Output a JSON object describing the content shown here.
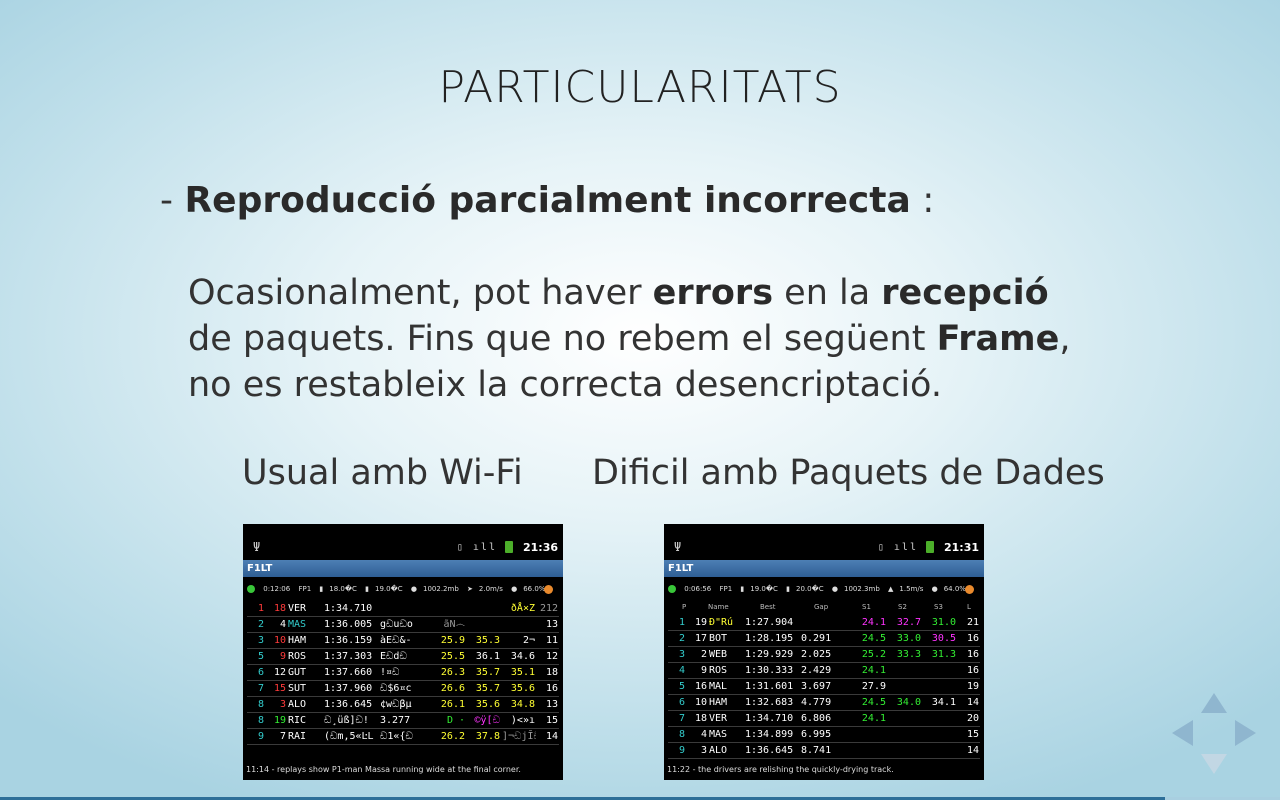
{
  "slide": {
    "title": "PARTICULARITATS",
    "bullet_dash": "- ",
    "bullet_bold": "Reproducció parcialment incorrecta",
    "bullet_colon": " :",
    "para": {
      "t1": "Ocasionalment, pot haver ",
      "b1": "errors",
      "t2": " en la ",
      "b2": "recepció",
      "t3": " de paquets. Fins que no rebem el següent ",
      "b3": "Frame",
      "t4": ", no es restableix la correcta desencriptació."
    },
    "caption_left": "Usual amb Wi-Fi",
    "caption_right": "Dificil amb Paquets de Dades",
    "progress_fraction": 0.91
  },
  "phone_left": {
    "usb_icon": "usb-icon",
    "clock": "21:36",
    "app_title": "F1LT",
    "session_time": "0:12:06",
    "session": "FP1",
    "air_temp": "18.0�C",
    "track_temp": "19.0�C",
    "pressure": "1002.2mb",
    "wind": "2.0m/s",
    "humidity": "66.0%",
    "rows": [
      {
        "pos": "1",
        "num": "18",
        "driver": "VER",
        "best": "1:34.710",
        "gap": "",
        "s1": "",
        "s2": "",
        "s3": "ðÅ×Z",
        "lap": "212",
        "pos_c": "c-red",
        "num_c": "c-red",
        "drv_c": "c-white",
        "s1_c": "c-yellow",
        "s2_c": "c-yellow",
        "s3_c": "c-yellow",
        "lap_c": "c-grey"
      },
      {
        "pos": "2",
        "num": "4",
        "driver": "MAS",
        "best": "1:36.005",
        "gap": "gඩuඩo",
        "s1": "ãN෴",
        "s2": "",
        "s3": "",
        "lap": "13",
        "pos_c": "c-cyan",
        "num_c": "c-white",
        "drv_c": "c-cyan",
        "s1_c": "c-grey",
        "s2_c": "c-white",
        "s3_c": "c-white",
        "lap_c": "c-white"
      },
      {
        "pos": "3",
        "num": "10",
        "driver": "HAM",
        "best": "1:36.159",
        "gap": "àEඩ&-",
        "s1": "25.9",
        "s2": "35.3",
        "s3": "2¬",
        "lap": "11",
        "pos_c": "c-cyan",
        "num_c": "c-red",
        "drv_c": "c-white",
        "s1_c": "c-yellow",
        "s2_c": "c-yellow",
        "s3_c": "c-white",
        "lap_c": "c-white"
      },
      {
        "pos": "5",
        "num": "9",
        "driver": "ROS",
        "best": "1:37.303",
        "gap": "Eඩdඩ",
        "s1": "25.5",
        "s2": "36.1",
        "s3": "34.6",
        "lap": "12",
        "pos_c": "c-cyan",
        "num_c": "c-red",
        "drv_c": "c-white",
        "s1_c": "c-yellow",
        "s2_c": "c-white",
        "s3_c": "c-white",
        "lap_c": "c-white"
      },
      {
        "pos": "6",
        "num": "12",
        "driver": "GUT",
        "best": "1:37.660",
        "gap": "!¤ඩ",
        "s1": "26.3",
        "s2": "35.7",
        "s3": "35.1",
        "lap": "18",
        "pos_c": "c-cyan",
        "num_c": "c-white",
        "drv_c": "c-white",
        "s1_c": "c-yellow",
        "s2_c": "c-yellow",
        "s3_c": "c-yellow",
        "lap_c": "c-white"
      },
      {
        "pos": "7",
        "num": "15",
        "driver": "SUT",
        "best": "1:37.960",
        "gap": "ඩ$6¤c",
        "s1": "26.6",
        "s2": "35.7",
        "s3": "35.6",
        "lap": "16",
        "pos_c": "c-cyan",
        "num_c": "c-red",
        "drv_c": "c-white",
        "s1_c": "c-yellow",
        "s2_c": "c-yellow",
        "s3_c": "c-yellow",
        "lap_c": "c-white"
      },
      {
        "pos": "8",
        "num": "3",
        "driver": "ALO",
        "best": "1:36.645",
        "gap": "¢wඩβμ",
        "s1": "26.1",
        "s2": "35.6",
        "s3": "34.8",
        "lap": "13",
        "pos_c": "c-cyan",
        "num_c": "c-red",
        "drv_c": "c-white",
        "s1_c": "c-yellow",
        "s2_c": "c-yellow",
        "s3_c": "c-yellow",
        "lap_c": "c-white"
      },
      {
        "pos": "8",
        "num": "19",
        "driver": "RIC",
        "best": "ඩ¸üß]ඩ!",
        "gap": "3.277",
        "s1": "D ·",
        "s2": "©ÿ[ඩ",
        "s3": ")<»ı",
        "lap": "15",
        "pos_c": "c-cyan",
        "num_c": "c-green",
        "drv_c": "c-white",
        "s1_c": "c-green",
        "s2_c": "c-magenta",
        "s3_c": "c-white",
        "lap_c": "c-white"
      },
      {
        "pos": "9",
        "num": "7",
        "driver": "RAI",
        "best": "(ඩm,5«ĿL",
        "gap": "ඩ1«{ඩ",
        "s1": "26.2",
        "s2": "37.8",
        "s3": "]¬ඩjĪඩ",
        "lap": "14",
        "pos_c": "c-cyan",
        "num_c": "c-white",
        "drv_c": "c-white",
        "s1_c": "c-yellow",
        "s2_c": "c-yellow",
        "s3_c": "c-grey",
        "lap_c": "c-white"
      }
    ],
    "footer": "11:14 - replays show P1-man Massa running wide at the final corner."
  },
  "phone_right": {
    "usb_icon": "usb-icon",
    "clock": "21:31",
    "app_title": "F1LT",
    "session_time": "0:06:56",
    "session": "FP1",
    "air_temp": "19.0�C",
    "track_temp": "20.0�C",
    "pressure": "1002.3mb",
    "wind": "1.5m/s",
    "humidity": "64.0%",
    "headers": {
      "p": "P",
      "name": "Name",
      "best": "Best",
      "gap": "Gap",
      "s1": "S1",
      "s2": "S2",
      "s3": "S3",
      "l": "L"
    },
    "rows": [
      {
        "pos": "1",
        "num": "19",
        "driver": "Ð\"Rú",
        "best": "1:27.904",
        "gap": "",
        "s1": "24.1",
        "s2": "32.7",
        "s3": "31.0",
        "lap": "21",
        "pos_c": "c-cyan",
        "num_c": "c-white",
        "drv_c": "c-yellow",
        "s1_c": "c-magenta",
        "s2_c": "c-magenta",
        "s3_c": "c-green",
        "lap_c": "c-white"
      },
      {
        "pos": "2",
        "num": "17",
        "driver": "BOT",
        "best": "1:28.195",
        "gap": "0.291",
        "s1": "24.5",
        "s2": "33.0",
        "s3": "30.5",
        "lap": "16",
        "pos_c": "c-cyan",
        "num_c": "c-white",
        "drv_c": "c-white",
        "s1_c": "c-green",
        "s2_c": "c-green",
        "s3_c": "c-magenta",
        "lap_c": "c-white"
      },
      {
        "pos": "3",
        "num": "2",
        "driver": "WEB",
        "best": "1:29.929",
        "gap": "2.025",
        "s1": "25.2",
        "s2": "33.3",
        "s3": "31.3",
        "lap": "16",
        "pos_c": "c-cyan",
        "num_c": "c-white",
        "drv_c": "c-white",
        "s1_c": "c-green",
        "s2_c": "c-green",
        "s3_c": "c-green",
        "lap_c": "c-white"
      },
      {
        "pos": "4",
        "num": "9",
        "driver": "ROS",
        "best": "1:30.333",
        "gap": "2.429",
        "s1": "24.1",
        "s2": "",
        "s3": "",
        "lap": "16",
        "pos_c": "c-cyan",
        "num_c": "c-white",
        "drv_c": "c-white",
        "s1_c": "c-green",
        "s2_c": "c-white",
        "s3_c": "c-white",
        "lap_c": "c-white"
      },
      {
        "pos": "5",
        "num": "16",
        "driver": "MAL",
        "best": "1:31.601",
        "gap": "3.697",
        "s1": "27.9",
        "s2": "",
        "s3": "",
        "lap": "19",
        "pos_c": "c-cyan",
        "num_c": "c-white",
        "drv_c": "c-white",
        "s1_c": "c-white",
        "s2_c": "c-white",
        "s3_c": "c-white",
        "lap_c": "c-white"
      },
      {
        "pos": "6",
        "num": "10",
        "driver": "HAM",
        "best": "1:32.683",
        "gap": "4.779",
        "s1": "24.5",
        "s2": "34.0",
        "s3": "34.1",
        "lap": "14",
        "pos_c": "c-cyan",
        "num_c": "c-white",
        "drv_c": "c-white",
        "s1_c": "c-green",
        "s2_c": "c-green",
        "s3_c": "c-white",
        "lap_c": "c-white"
      },
      {
        "pos": "7",
        "num": "18",
        "driver": "VER",
        "best": "1:34.710",
        "gap": "6.806",
        "s1": "24.1",
        "s2": "",
        "s3": "",
        "lap": "20",
        "pos_c": "c-cyan",
        "num_c": "c-white",
        "drv_c": "c-white",
        "s1_c": "c-green",
        "s2_c": "c-white",
        "s3_c": "c-white",
        "lap_c": "c-white"
      },
      {
        "pos": "8",
        "num": "4",
        "driver": "MAS",
        "best": "1:34.899",
        "gap": "6.995",
        "s1": "",
        "s2": "",
        "s3": "",
        "lap": "15",
        "pos_c": "c-cyan",
        "num_c": "c-white",
        "drv_c": "c-white",
        "s1_c": "c-white",
        "s2_c": "c-white",
        "s3_c": "c-white",
        "lap_c": "c-white"
      },
      {
        "pos": "9",
        "num": "3",
        "driver": "ALO",
        "best": "1:36.645",
        "gap": "8.741",
        "s1": "",
        "s2": "",
        "s3": "",
        "lap": "14",
        "pos_c": "c-cyan",
        "num_c": "c-white",
        "drv_c": "c-white",
        "s1_c": "c-white",
        "s2_c": "c-white",
        "s3_c": "c-white",
        "lap_c": "c-white"
      }
    ],
    "footer": "11:22 - the drivers are relishing the quickly-drying track."
  },
  "nav": {
    "up_icon": "up-arrow-icon",
    "down_icon": "down-arrow-icon",
    "left_icon": "left-arrow-icon",
    "right_icon": "right-arrow-icon"
  }
}
